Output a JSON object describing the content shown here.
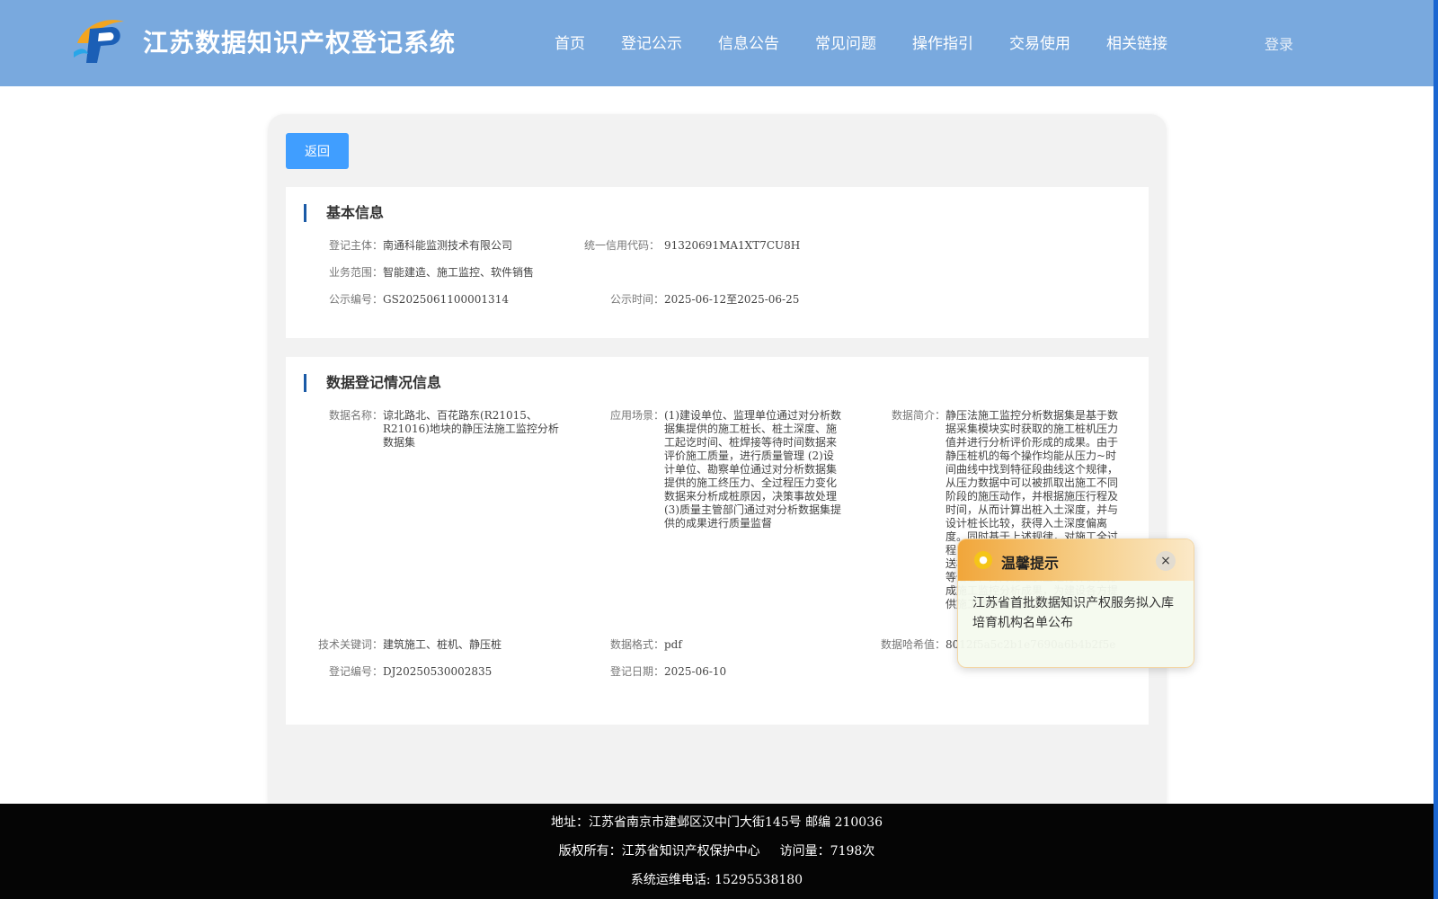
{
  "header": {
    "title": "江苏数据知识产权登记系统",
    "nav": [
      "首页",
      "登记公示",
      "信息公告",
      "常见问题",
      "操作指引",
      "交易使用",
      "相关链接"
    ],
    "login": "登录"
  },
  "back_button": "返回",
  "basic_info": {
    "title": "基本信息",
    "subject_label": "登记主体：",
    "subject_value": "南通科能监测技术有限公司",
    "credit_label": "统一信用代码：",
    "credit_value": "91320691MA1XT7CU8H",
    "scope_label": "业务范围：",
    "scope_value": "智能建造、施工监控、软件销售",
    "pub_no_label": "公示编号：",
    "pub_no_value": "GS2025061100001314",
    "pub_time_label": "公示时间：",
    "pub_time_value": "2025-06-12至2025-06-25"
  },
  "data_info": {
    "title": "数据登记情况信息",
    "name_label": "数据名称：",
    "name_value": "谅北路北、百花路东(R21015、R21016)地块的静压法施工监控分析数据集",
    "scene_label": "应用场景：",
    "scene_value": "(1)建设单位、监理单位通过对分析数据集提供的施工桩长、桩土深度、施工起讫时间、桩焊接等待时间数据来评价施工质量，进行质量管理 (2)设计单位、勘察单位通过对分析数据集提供的施工终压力、全过程压力变化数据来分析成桩原因，决策事故处理 (3)质量主管部门通过对分析数据集提供的成果进行质量监督",
    "intro_label": "数据简介：",
    "intro_value": "静压法施工监控分析数据集是基于数据采集模块实时获取的施工桩机压力值并进行分析评价形成的成果。由于静压桩机的每个操作均能从压力~时间曲线中找到特征段曲线这个规律，从压力数据中可以被抓取出施工不同阶段的施压动作，并根据施压行程及时间，从而计算出桩入土深度，并与设计桩长比较，获得入土深度偏离度。同时基于上述规律，对施工全过程的动态监控，分析出压桩、接桩、送桩等各阶段的施工时间、桩土深度等信息，并对施工质量进行评价，形成施工监控分析成果，为建设各方提供施工质量评价及决策依据。",
    "keywords_label": "技术关键词：",
    "keywords_value": "建筑施工、桩机、静压桩",
    "format_label": "数据格式：",
    "format_value": "pdf",
    "hash_label": "数据哈希值：",
    "hash_value": "8012f5a5c2b1e7690a6b4b2f5e",
    "reg_no_label": "登记编号：",
    "reg_no_value": "DJ20250530002835",
    "reg_date_label": "登记日期：",
    "reg_date_value": "2025-06-10"
  },
  "footer": {
    "address": "地址：江苏省南京市建邺区汉中门大街145号 邮编 210036",
    "copyright": "版权所有：江苏省知识产权保护中心",
    "visits": "访问量：7198次",
    "phone": "系统运维电话: 15295538180"
  },
  "popup": {
    "title": "温馨提示",
    "close": "×",
    "body": "江苏省首批数据知识产权服务拟入库培育机构名单公布"
  }
}
